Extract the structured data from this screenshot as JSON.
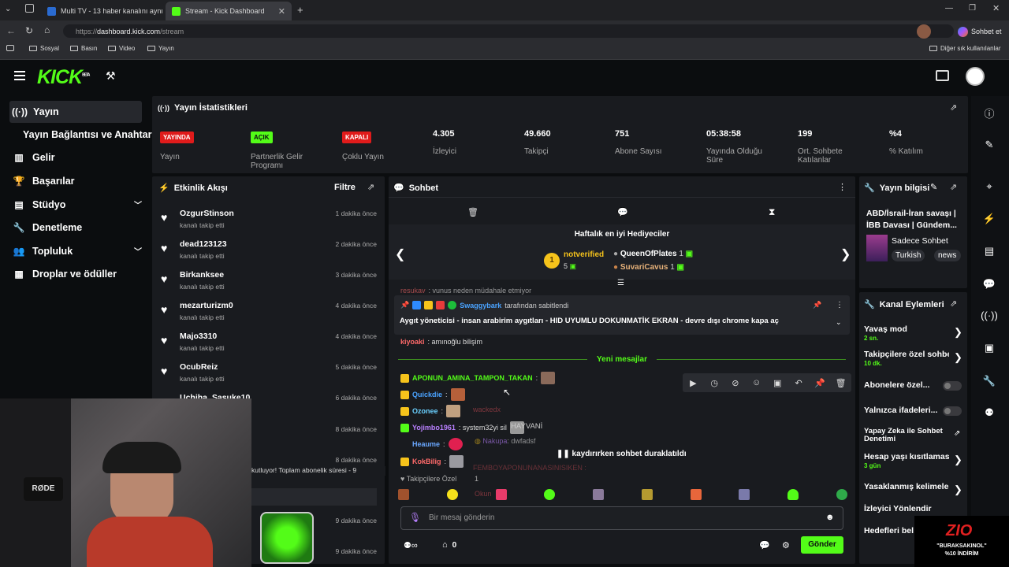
{
  "browser": {
    "tabs": [
      {
        "title": "Multi TV - 13 haber kanalını aynı a",
        "active": false
      },
      {
        "title": "Stream - Kick Dashboard",
        "active": true
      }
    ],
    "url_prefix": "https://",
    "url_domain": "dashboard.kick.com",
    "url_path": "/stream",
    "profile_label": "Sohbet et",
    "bookmarks": [
      "Sosyal",
      "Basın",
      "Video",
      "Yayın"
    ],
    "other_bookmarks": "Diğer sık kullanılanlar"
  },
  "nav": {
    "logo": "KICK",
    "logo_beta": "BETA",
    "items": [
      {
        "label": "Yayın",
        "icon": "broadcast-icon",
        "active": true
      },
      {
        "label": "Yayın Bağlantısı ve Anahtarı"
      },
      {
        "label": "Gelir",
        "icon": "bar-chart-icon"
      },
      {
        "label": "Başarılar",
        "icon": "trophy-icon"
      },
      {
        "label": "Stüdyo",
        "icon": "studio-icon",
        "chevron": true
      },
      {
        "label": "Denetleme",
        "icon": "wrench-icon"
      },
      {
        "label": "Topluluk",
        "icon": "community-icon",
        "chevron": true
      },
      {
        "label": "Droplar ve ödüller",
        "icon": "drops-icon"
      }
    ]
  },
  "stats": {
    "title": "Yayın İstatistikleri",
    "items": [
      {
        "badge": "YAYINDA",
        "badge_color": "#e01b1b",
        "label": "Yayın"
      },
      {
        "badge": "AÇIK",
        "badge_color": "#53fc18",
        "label": "Partnerlik Gelir Programı"
      },
      {
        "badge": "KAPALI",
        "badge_color": "#e01b1b",
        "label": "Çoklu Yayın"
      },
      {
        "value": "4.305",
        "label": "İzleyici"
      },
      {
        "value": "49.660",
        "label": "Takipçi"
      },
      {
        "value": "751",
        "label": "Abone Sayısı"
      },
      {
        "value": "05:38:58",
        "label": "Yayında Olduğu Süre"
      },
      {
        "value": "199",
        "label": "Ort. Sohbete Katılanlar"
      },
      {
        "value": "%4",
        "label": "% Katılım"
      }
    ]
  },
  "activity": {
    "title": "Etkinlik Akışı",
    "filter": "Filtre",
    "items": [
      {
        "name": "OzgurStinson",
        "action": "kanalı takip etti",
        "time": "1 dakika önce"
      },
      {
        "name": "dead123123",
        "action": "kanalı takip etti",
        "time": "2 dakika önce"
      },
      {
        "name": "Birkanksee",
        "action": "kanalı takip etti",
        "time": "3 dakika önce"
      },
      {
        "name": "mezarturizm0",
        "action": "kanalı takip etti",
        "time": "4 dakika önce"
      },
      {
        "name": "Majo3310",
        "action": "kanalı takip etti",
        "time": "4 dakika önce"
      },
      {
        "name": "OcubReiz",
        "action": "kanalı takip etti",
        "time": "5 dakika önce"
      },
      {
        "name": "Uchiha_Sasuke10",
        "action": "",
        "time": "6 dakika önce"
      },
      {
        "name": "",
        "action": "",
        "time": "8 dakika önce"
      },
      {
        "name": "",
        "action": "kutluyor! Toplam abonelik süresi - 9",
        "time": "8 dakika önce"
      },
      {
        "name": "",
        "action": "",
        "time": "9 dakika önce"
      },
      {
        "name": "",
        "action": "",
        "time": "9 dakika önce"
      }
    ]
  },
  "chat": {
    "title": "Sohbet",
    "gifters_title": "Haftalık en iyi Hediyeciler",
    "top_gifter": "notverified",
    "top_gifter_count": "5",
    "gifter2": "QueenOfPlates",
    "gifter2_count": "1",
    "gifter3": "SuvariCavus",
    "gifter3_count": "1",
    "partial_line_user": "resukav",
    "partial_line": ": vunus neden müdahale etmiyor",
    "pinned_by": "Swaggybark",
    "pinned_suffix": "tarafından sabitlendi",
    "pinned_message": "Aygıt yöneticisi - insan arabirim aygıtları - HID UYUMLU DOKUNMATİK EKRAN - devre dışı chrome kapa aç",
    "line_kiyoaki_user": "kiyoaki",
    "line_kiyoaki_text": ": amınoğlu bilişim",
    "new_messages": "Yeni mesajlar",
    "messages": [
      {
        "user": "APONUN_AMINA_TAMPON_TAKAN",
        "color": "#53fc18",
        "text": ":"
      },
      {
        "user": "Quickdie",
        "color": "#4aa3ff",
        "text": ":"
      },
      {
        "user": "Ozonee",
        "color": "#6ad0ff",
        "text": ":"
      },
      {
        "user": "Yojimbo1961",
        "color": "#b980ff",
        "text": ": system32yi sil"
      },
      {
        "user": "Heaume",
        "color": "#6aa8ff",
        "text": ":"
      },
      {
        "user": "KokBilig",
        "color": "#ff6a6a",
        "text": ":"
      }
    ],
    "ghost_user1": "wackedx",
    "ghost_word": "HAYVANİ",
    "ghost_user2": "Nakupa",
    "ghost_text2": ": dwfadsf",
    "paused": "kaydırırken sohbet duraklatıldı",
    "ghost_line": "FEMBOYAPONUNANASINISIKEN :",
    "followers_only": "Takipçilere Özel",
    "followers_count": "1",
    "ghost_user3": "Okun",
    "input_placeholder": "Bir mesaj gönderin",
    "points_count": "0",
    "send": "Gönder"
  },
  "stream_info": {
    "title": "Yayın bilgisi",
    "stream_title": "ABD/İsrail-İran savaşı | İBB Davası | Gündem...",
    "category": "Sadece Sohbet",
    "tags": [
      "Turkish",
      "news"
    ]
  },
  "channel_actions": {
    "title": "Kanal Eylemleri",
    "items": [
      {
        "label": "Yavaş mod",
        "sub": "2 sn.",
        "type": "chevron"
      },
      {
        "label": "Takipçilere özel sohbet",
        "sub": "10 dk.",
        "type": "chevron"
      },
      {
        "label": "Abonelere özel...",
        "type": "toggle"
      },
      {
        "label": "Yalnızca ifadeleri...",
        "type": "toggle"
      },
      {
        "label": "Yapay Zeka ile Sohbet Denetimi",
        "type": "external"
      },
      {
        "label": "Hesap yaşı kısıtlaması",
        "sub": "3 gün",
        "type": "chevron"
      },
      {
        "label": "Yasaklanmış kelimeler",
        "type": "chevron"
      },
      {
        "label": "İzleyici Yönlendir",
        "type": "none"
      },
      {
        "label": "Hedefleri bel",
        "type": "none"
      }
    ]
  },
  "overlay": {
    "webcam_mic_text": "RØDE",
    "promo_logo": "ZIO",
    "promo_code": "\"BURAKSAKINOL\"",
    "promo_discount": "%10 İNDİRİM"
  },
  "colors": {
    "accent": "#53fc18",
    "live": "#e01b1b",
    "panel": "#191b1f",
    "bg": "#0b0d0f"
  }
}
